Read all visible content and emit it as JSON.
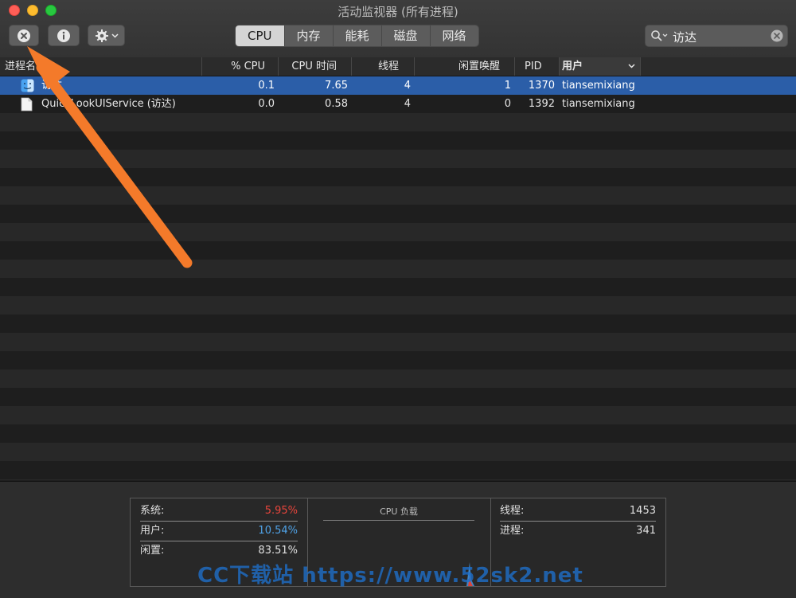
{
  "window": {
    "title": "活动监视器 (所有进程)"
  },
  "toolbar": {
    "quit_process_icon": "x-circle-icon",
    "info_icon": "info-icon",
    "action_icon": "gear-icon",
    "tabs": [
      {
        "label": "CPU",
        "active": true
      },
      {
        "label": "内存",
        "active": false
      },
      {
        "label": "能耗",
        "active": false
      },
      {
        "label": "磁盘",
        "active": false
      },
      {
        "label": "网络",
        "active": false
      }
    ],
    "search": {
      "value": "访达"
    }
  },
  "table": {
    "columns": {
      "name": "进程名",
      "cpu_pct": "% CPU",
      "cpu_time": "CPU 时间",
      "threads": "线程",
      "idle_wakeups": "闲置唤醒",
      "pid": "PID",
      "user": "用户"
    },
    "rows": [
      {
        "name": "访达",
        "cpu_pct": "0.1",
        "cpu_time": "7.65",
        "threads": "4",
        "idle_wakeups": "1",
        "pid": "1370",
        "user": "tiansemixiang",
        "selected": true,
        "icon": "finder-icon"
      },
      {
        "name": "QuickLookUIService (访达)",
        "cpu_pct": "0.0",
        "cpu_time": "0.58",
        "threads": "4",
        "idle_wakeups": "0",
        "pid": "1392",
        "user": "tiansemixiang",
        "selected": false,
        "icon": "document-icon"
      }
    ]
  },
  "summary": {
    "system": {
      "label": "系统:",
      "value": "5.95%",
      "color": "#e8453c"
    },
    "user": {
      "label": "用户:",
      "value": "10.54%",
      "color": "#4fa3e8"
    },
    "idle": {
      "label": "闲置:",
      "value": "83.51%"
    },
    "cpu_load_title": "CPU 负载",
    "threads": {
      "label": "线程:",
      "value": "1453"
    },
    "processes": {
      "label": "进程:",
      "value": "341"
    }
  },
  "watermark": "CC下载站 https://www.52sk2.net",
  "colors": {
    "selection": "#2b5ea8",
    "annotation_arrow": "#f47a2a"
  }
}
